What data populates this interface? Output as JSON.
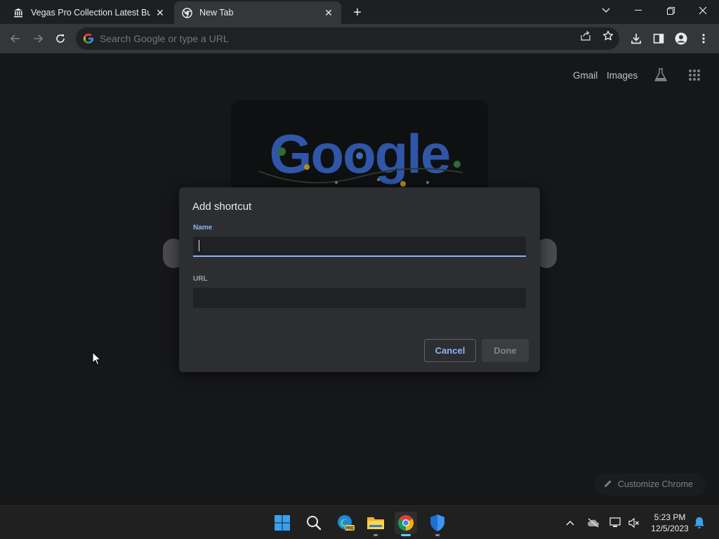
{
  "tabs": [
    {
      "title": "Vegas Pro Collection Latest Build",
      "icon": "bank-icon",
      "active": false
    },
    {
      "title": "New Tab",
      "icon": "chrome-icon",
      "active": true
    }
  ],
  "omnibox": {
    "placeholder": "Search Google or type a URL"
  },
  "ntp": {
    "links": {
      "gmail": "Gmail",
      "images": "Images"
    },
    "doodle_text": "Google",
    "customize_label": "Customize Chrome"
  },
  "dialog": {
    "title": "Add shortcut",
    "name_label": "Name",
    "name_value": "",
    "url_label": "URL",
    "url_value": "",
    "cancel_label": "Cancel",
    "done_label": "Done"
  },
  "taskbar": {
    "time": "5:23 PM",
    "date": "12/5/2023",
    "edge_badge": "PRE"
  },
  "colors": {
    "accent": "#8ab4f8",
    "dialog_bg": "#2d2e31",
    "page_bg": "#161719"
  }
}
